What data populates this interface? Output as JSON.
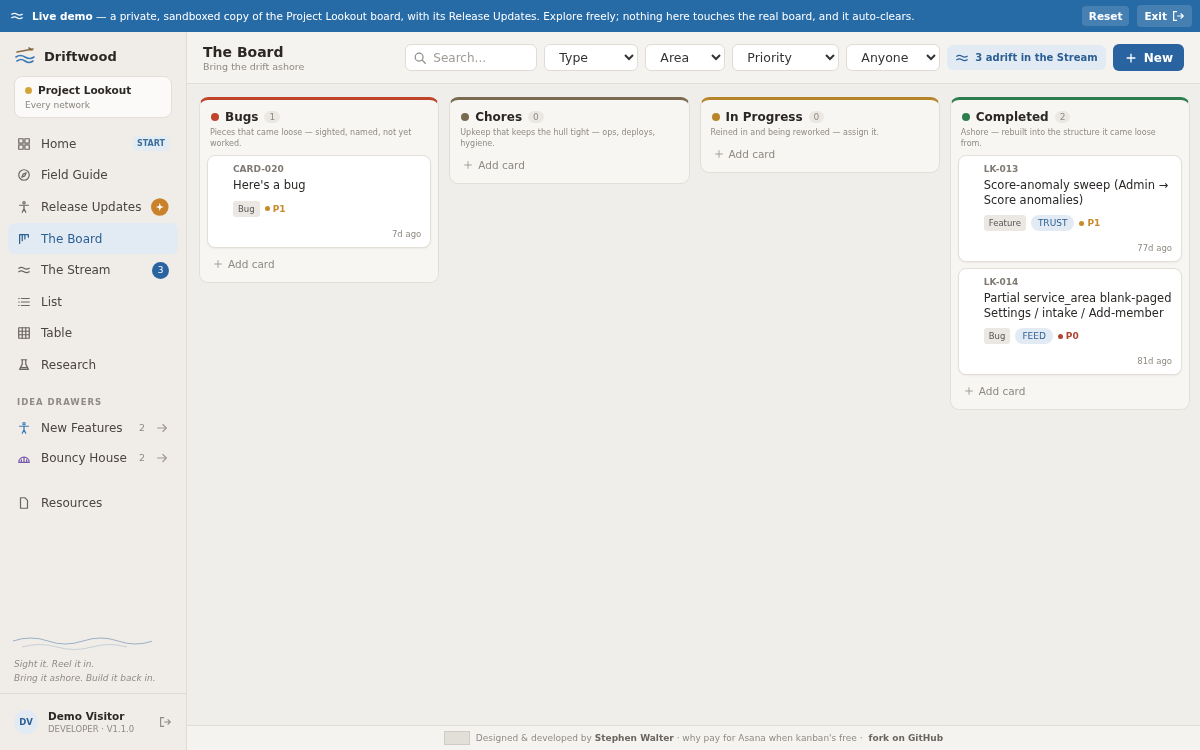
{
  "banner": {
    "text": "**Live demo** — a private, sandboxed copy of the Project Lookout board, with its Release Updates. Explore freely; nothing here touches the real board, and it auto-clears.",
    "reset": "Reset",
    "exit": "Exit"
  },
  "sidebar": {
    "brand": "Driftwood",
    "project": {
      "name": "Project Lookout",
      "subtitle": "Every network",
      "color": "#d4a43a"
    },
    "items": [
      {
        "label": "Home",
        "selected": false,
        "badge": {
          "kind": "tag",
          "text": "START"
        }
      },
      {
        "label": "Field Guide",
        "selected": false
      },
      {
        "label": "Release Updates",
        "selected": false,
        "badge": {
          "kind": "spark"
        }
      },
      {
        "label": "The Board",
        "selected": true
      },
      {
        "label": "The Stream",
        "selected": false,
        "badge": {
          "kind": "count",
          "text": "3"
        }
      },
      {
        "label": "List",
        "selected": false
      },
      {
        "label": "Table",
        "selected": false
      },
      {
        "label": "Research",
        "selected": false
      }
    ],
    "section": "IDEA DRAWERS",
    "drawers": [
      {
        "label": "New Features",
        "count": "2"
      },
      {
        "label": "Bouncy House",
        "count": "2"
      }
    ],
    "resources": "Resources",
    "tagline": [
      "Sight it. Reel it in.",
      "Bring it ashore. Build it back in."
    ],
    "user": {
      "initials": "DV",
      "name": "Demo Visitor",
      "role": "DEVELOPER · V1.1.0"
    }
  },
  "header": {
    "title": "The Board",
    "subtitle": "Bring the drift ashore",
    "search": {
      "placeholder": "Search..."
    },
    "filters": [
      "Type",
      "Area",
      "Priority",
      "Anyone"
    ],
    "stream": "3 adrift in the Stream",
    "new": "New"
  },
  "columns": [
    {
      "name": "Bugs",
      "color": "#c0432c",
      "count": "1",
      "description": "Pieces that came loose — sighted, named, not yet worked.",
      "add": "Add card",
      "cards": [
        {
          "id": "CARD-020",
          "title": "Here's a bug",
          "tags": [
            {
              "kind": "type",
              "text": "Bug"
            }
          ],
          "priority": {
            "text": "P1",
            "color": "#c88a2a"
          },
          "age": "7d ago"
        }
      ]
    },
    {
      "name": "Chores",
      "color": "#7a6a50",
      "count": "0",
      "description": "Upkeep that keeps the hull tight — ops, deploys, hygiene.",
      "add": "Add card"
    },
    {
      "name": "In Progress",
      "color": "#b8862a",
      "count": "0",
      "description": "Reined in and being reworked — assign it.",
      "add": "Add card"
    },
    {
      "name": "Completed",
      "color": "#2e7d4f",
      "count": "2",
      "description": "Ashore — rebuilt into the structure it came loose from.",
      "add": "Add card",
      "cards": [
        {
          "id": "LK-013",
          "title": "Score-anomaly sweep (Admin → Score anomalies)",
          "tags": [
            {
              "kind": "type",
              "text": "Feature"
            },
            {
              "kind": "area",
              "text": "TRUST"
            }
          ],
          "priority": {
            "text": "P1",
            "color": "#c88a2a"
          },
          "age": "77d ago"
        },
        {
          "id": "LK-014",
          "title": "Partial service_area blank-paged Settings / intake / Add-member",
          "tags": [
            {
              "kind": "type",
              "text": "Bug"
            },
            {
              "kind": "area",
              "text": "FEED"
            }
          ],
          "priority": {
            "text": "P0",
            "color": "#b0442f"
          },
          "age": "81d ago"
        }
      ]
    }
  ],
  "footer": {
    "text": "Designed & developed by **Stephen Walter** · why pay for Asana when kanban's free ·",
    "link": "fork on GitHub"
  }
}
